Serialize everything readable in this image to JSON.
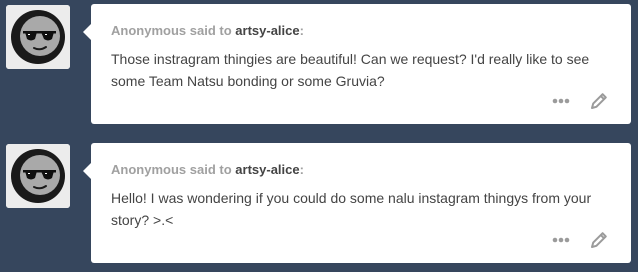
{
  "posts": [
    {
      "asker": "Anonymous",
      "said_to": "said to",
      "blog": "artsy-alice",
      "colon": ":",
      "question": "Those instragram thingies are beautiful! Can we request? I'd really like to see some Team Natsu bonding or some Gruvia?"
    },
    {
      "asker": "Anonymous",
      "said_to": "said to",
      "blog": "artsy-alice",
      "colon": ":",
      "question": "Hello! I was wondering if you could do some nalu instagram thingys from your story? >.<"
    }
  ],
  "icons": {
    "avatar": "anonymous-sunglasses-avatar",
    "more": "ellipsis-icon",
    "edit": "pencil-icon"
  },
  "colors": {
    "dashboard_bg": "#36465d",
    "card_bg": "#ffffff",
    "muted_text": "#a0a0a0",
    "body_text": "#444444",
    "icon": "#9b9b9b"
  }
}
